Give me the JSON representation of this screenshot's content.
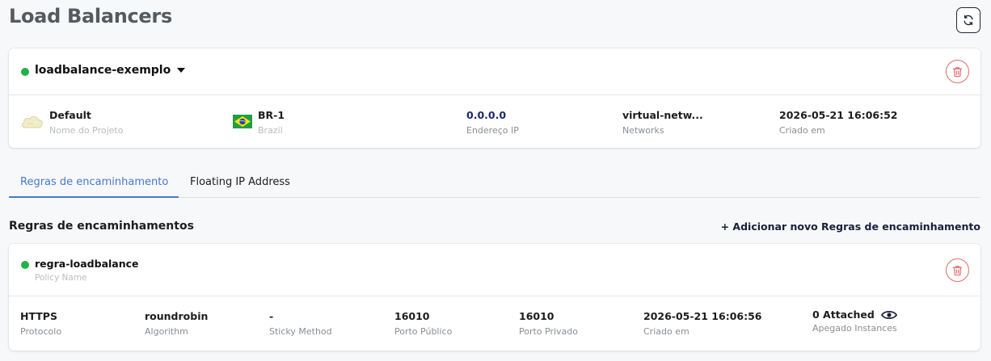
{
  "page": {
    "title": "Load Balancers"
  },
  "load_balancer": {
    "name": "loadbalance-exemplo",
    "status_color": "#22b24c",
    "fields": {
      "project": {
        "value": "Default",
        "label": "Nome do Projeto"
      },
      "region": {
        "value": "BR-1",
        "label": "Brazil"
      },
      "ip": {
        "value": "0.0.0.0",
        "label": "Endereço IP"
      },
      "network": {
        "value": "virtual-netw...",
        "label": "Networks"
      },
      "created": {
        "value": "2026-05-21 16:06:52",
        "label": "Criado em"
      }
    }
  },
  "tabs": [
    {
      "label": "Regras de encaminhamento",
      "active": true
    },
    {
      "label": "Floating IP Address",
      "active": false
    }
  ],
  "section": {
    "title": "Regras de encaminhamentos",
    "add_label": "+ Adicionar novo Regras de encaminhamento"
  },
  "rule": {
    "name": "regra-loadbalance",
    "name_label": "Policy Name",
    "fields": {
      "protocol": {
        "value": "HTTPS",
        "label": "Protocolo"
      },
      "algorithm": {
        "value": "roundrobin",
        "label": "Algorithm"
      },
      "sticky": {
        "value": "-",
        "label": "Sticky Method"
      },
      "public_port": {
        "value": "16010",
        "label": "Porto Público"
      },
      "private_port": {
        "value": "16010",
        "label": "Porto Privado"
      },
      "created": {
        "value": "2026-05-21 16:06:56",
        "label": "Criado em"
      },
      "attached": {
        "value": "0 Attached",
        "label": "Apegado Instances"
      }
    }
  },
  "colors": {
    "accent": "#4a78c9",
    "danger": "#e26d6d",
    "status_ok": "#22b24c"
  },
  "icons": [
    "refresh-icon",
    "trash-icon",
    "cloud-icon",
    "brazil-flag-icon",
    "eye-icon",
    "chevron-down-icon"
  ]
}
